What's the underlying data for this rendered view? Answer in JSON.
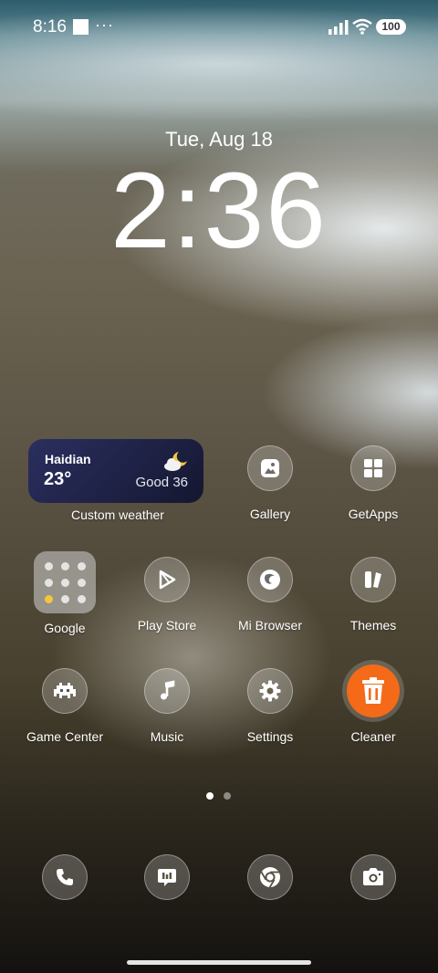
{
  "status_bar": {
    "time": "8:16",
    "dots": "···",
    "battery": "100"
  },
  "lockscreen": {
    "date": "Tue, Aug 18",
    "time": "2:36"
  },
  "weather_widget": {
    "city": "Haidian",
    "temperature": "23°",
    "air_quality": "Good 36",
    "label": "Custom weather",
    "icon": "partly-cloudy-night-icon"
  },
  "apps": {
    "gallery": "Gallery",
    "getapps": "GetApps",
    "google": "Google",
    "play_store": "Play Store",
    "mi_browser": "Mi Browser",
    "themes": "Themes",
    "game_center": "Game Center",
    "music": "Music",
    "settings": "Settings",
    "cleaner": "Cleaner"
  },
  "colors": {
    "cleaner_accent": "#f46a19",
    "weather_bg": "#1e2245"
  },
  "pager": {
    "pages": 2,
    "current": 1
  }
}
